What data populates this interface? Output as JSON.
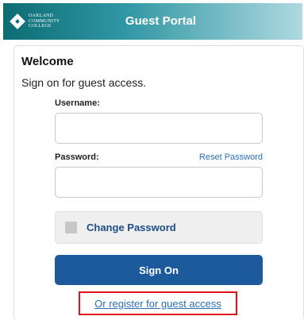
{
  "header": {
    "logo_lines": [
      "OAKLAND",
      "COMMUNITY",
      "COLLEGE"
    ],
    "title": "Guest Portal"
  },
  "form": {
    "welcome": "Welcome",
    "subtitle": "Sign on for guest access.",
    "username_label": "Username:",
    "username_value": "",
    "password_label": "Password:",
    "password_value": "",
    "reset_password_link": "Reset Password",
    "change_password_label": "Change Password",
    "change_password_checked": false,
    "sign_on_button": "Sign On",
    "register_link": "Or register for guest access"
  },
  "colors": {
    "header_start": "#0d6c73",
    "primary_button": "#1d5a9c",
    "link": "#2a6fb5",
    "highlight_border": "#e0131a"
  }
}
